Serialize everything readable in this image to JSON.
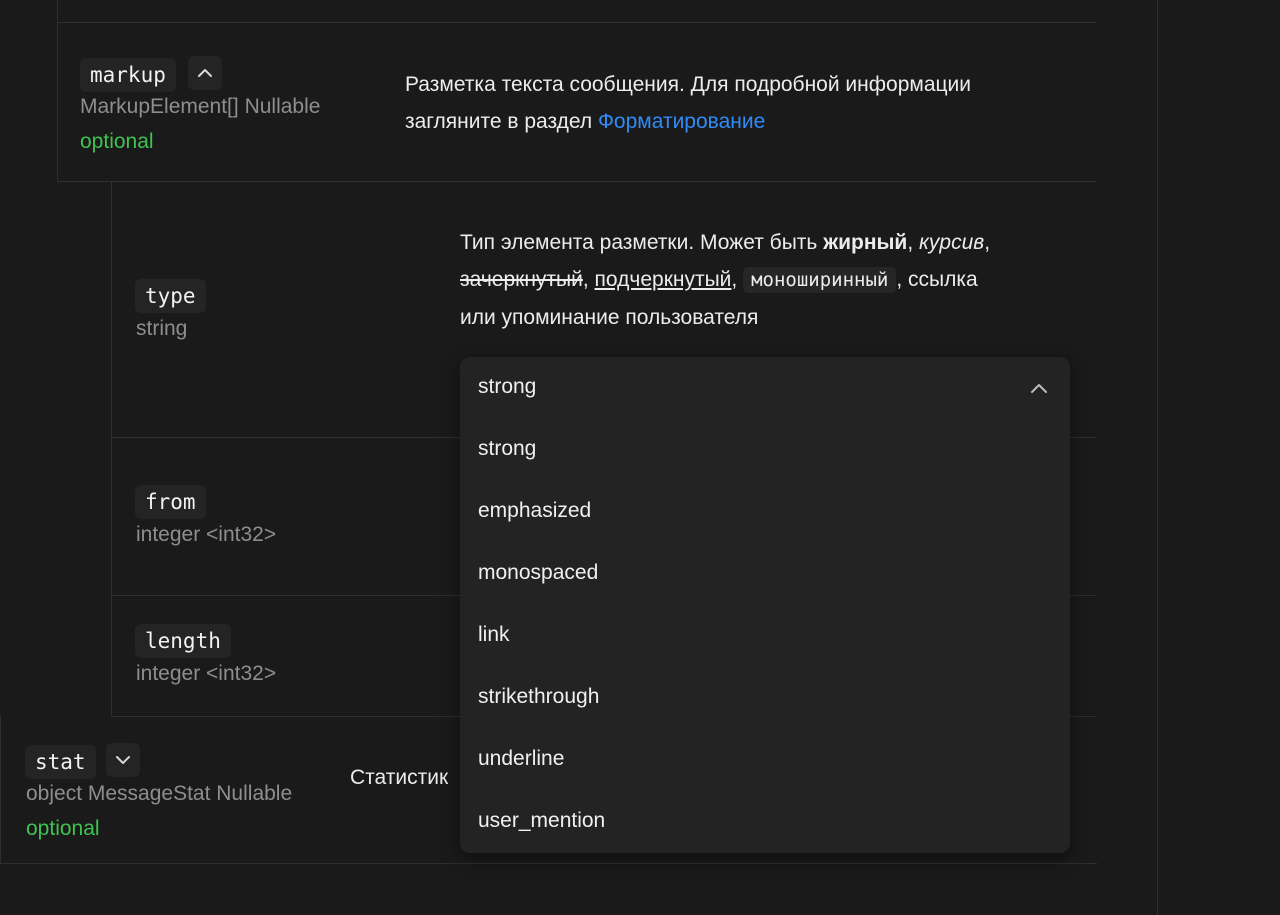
{
  "markup": {
    "name": "markup",
    "type": "MarkupElement[] Nullable",
    "required": "optional",
    "desc_line1": "Разметка текста сообщения. Для подробной информации",
    "desc_line2_prefix": "загляните в раздел ",
    "desc_link": "Форматирование"
  },
  "type_field": {
    "name": "type",
    "type": "string",
    "desc_part1": "Тип элемента разметки. Может быть ",
    "desc_bold": "жирный",
    "desc_sep1": ", ",
    "desc_italic": "курсив",
    "desc_sep2": ",",
    "desc_strike": "зачеркнутый",
    "desc_sep3": ", ",
    "desc_underline": "подчеркнутый",
    "desc_sep4": ", ",
    "desc_mono": "моноширинный",
    "desc_sep5": ", ссылка",
    "desc_line3": "или упоминание пользователя"
  },
  "from_field": {
    "name": "from",
    "type": "integer <int32>"
  },
  "length_field": {
    "name": "length",
    "type": "integer <int32>"
  },
  "stat": {
    "name": "stat",
    "type": "object MessageStat Nullable",
    "required": "optional",
    "desc_partial": "Статистик"
  },
  "dropdown": {
    "selected": "strong",
    "options": [
      "strong",
      "emphasized",
      "monospaced",
      "link",
      "strikethrough",
      "underline",
      "user_mention"
    ]
  },
  "icons": {
    "markup_toggle": "chevron-up-icon",
    "stat_toggle": "chevron-down-icon",
    "dropdown_toggle": "chevron-up-icon"
  },
  "colors": {
    "background": "#1a1a1a",
    "optional_green": "#3fc24f",
    "link_blue": "#2f8cf7",
    "muted_gray": "#8e8e8e"
  }
}
